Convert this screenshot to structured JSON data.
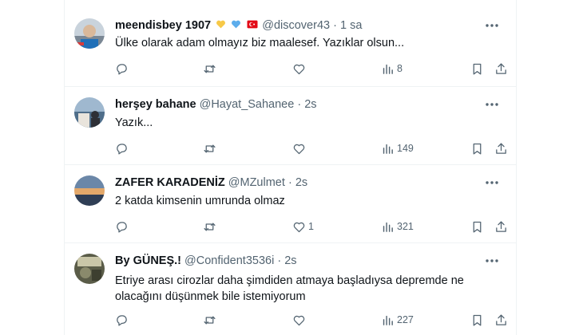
{
  "tweets": [
    {
      "name": "meendisbey 1907",
      "badges": [
        "yellow-heart",
        "blue-heart",
        "turkey-flag"
      ],
      "handle": "@discover43",
      "time": "1 sa",
      "text": "Ülke olarak adam olmayız biz maalesef. Yazıklar olsun...",
      "replies": "",
      "reposts": "",
      "likes": "",
      "views": "8"
    },
    {
      "name": "herşey bahane",
      "handle": "@Hayat_Sahanee",
      "time": "2s",
      "text": "Yazık...",
      "replies": "",
      "reposts": "",
      "likes": "",
      "views": "149"
    },
    {
      "name": "ZAFER KARADENİZ",
      "handle": "@MZulmet",
      "time": "2s",
      "text": "2 katda kimsenin umrunda olmaz",
      "replies": "",
      "reposts": "",
      "likes": "1",
      "views": "321"
    },
    {
      "name": "By GÜNEŞ.!",
      "handle": "@Confident3536i",
      "time": "2s",
      "text_lines": [
        "Etriye arası cirozlar daha şimdiden atmaya başladıysa depremde ne",
        "olacağını düşünmek bile istemiyorum"
      ],
      "replies": "",
      "reposts": "",
      "likes": "",
      "views": "227"
    }
  ],
  "separator": "·",
  "icons": [
    "reply-icon",
    "repost-icon",
    "like-icon",
    "views-icon",
    "bookmark-icon",
    "share-icon",
    "more-icon"
  ],
  "colors": {
    "text": "#0f1419",
    "muted": "#536471",
    "border": "#eff3f4"
  }
}
